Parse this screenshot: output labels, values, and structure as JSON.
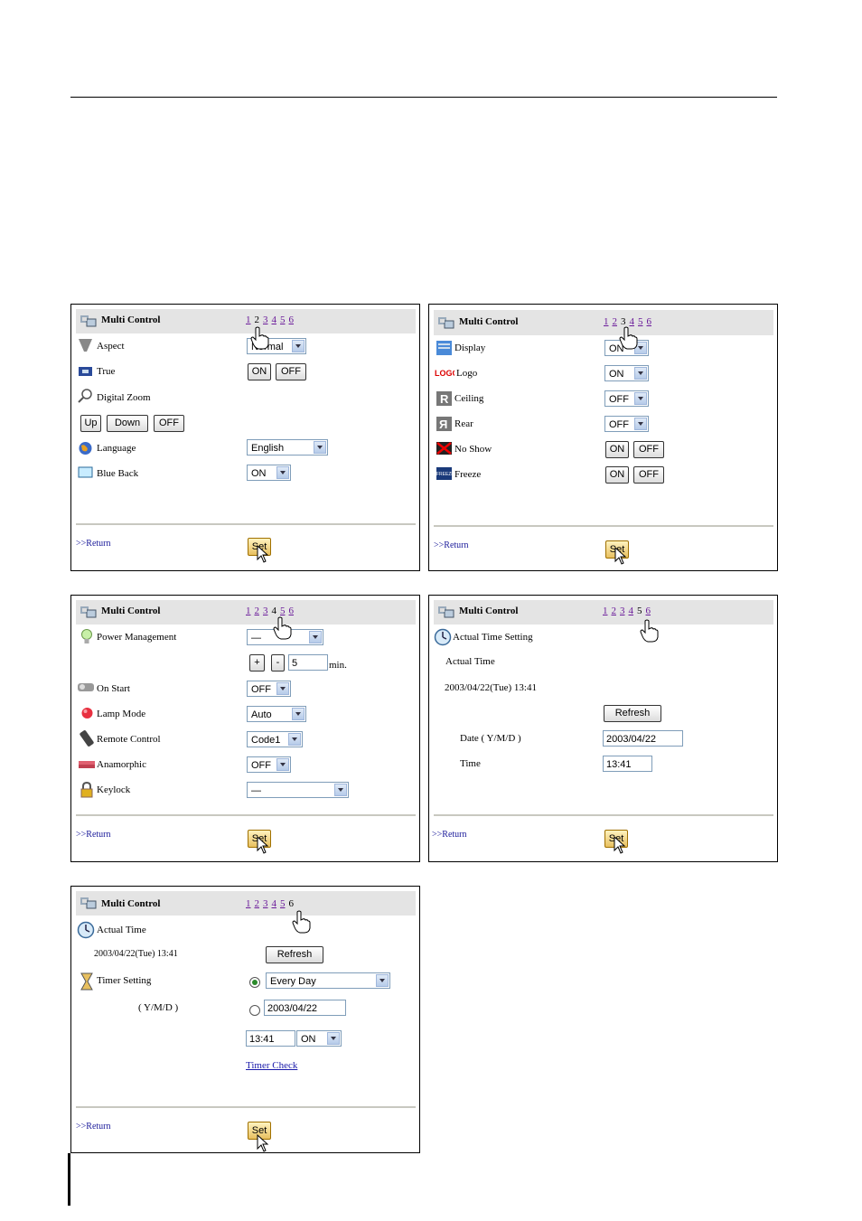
{
  "panels": [
    {
      "title": "Multi Control",
      "pages": [
        "1",
        "2",
        "3",
        "4",
        "5",
        "6"
      ],
      "rows": {
        "aspect": "Aspect",
        "aspect_value": "Normal",
        "true": "True",
        "digital_zoom": "Digital Zoom",
        "language": "Language",
        "language_value": "English",
        "blue_back": "Blue Back",
        "blue_back_value": "ON"
      },
      "buttons": {
        "on": "ON",
        "off": "OFF",
        "up": "Up",
        "down": "Down",
        "zoom_off": "OFF"
      },
      "return": ">>Return",
      "set": "Set"
    },
    {
      "title": "Multi Control",
      "pages": [
        "1",
        "2",
        "3",
        "4",
        "5",
        "6"
      ],
      "rows": {
        "display": "Display",
        "display_value": "ON",
        "logo": "Logo",
        "logo_value": "ON",
        "ceiling": "Ceiling",
        "ceiling_value": "OFF",
        "rear": "Rear",
        "rear_value": "OFF",
        "no_show": "No Show",
        "freeze": "Freeze"
      },
      "buttons": {
        "on": "ON",
        "off": "OFF"
      },
      "return": ">>Return",
      "set": "Set"
    },
    {
      "title": "Multi Control",
      "pages": [
        "1",
        "2",
        "3",
        "4",
        "5",
        "6"
      ],
      "rows": {
        "power_mgmt": "Power Management",
        "power_mgmt_value": "—",
        "plus": "+",
        "minus": "-",
        "minutes_value": "5",
        "min_unit": "min.",
        "on_start": "On Start",
        "on_start_value": "OFF",
        "lamp_mode": "Lamp Mode",
        "lamp_mode_value": "Auto",
        "remote_control": "Remote Control",
        "remote_control_value": "Code1",
        "anamorphic": "Anamorphic",
        "anamorphic_value": "OFF",
        "keylock": "Keylock",
        "keylock_value": "—"
      },
      "return": ">>Return",
      "set": "Set"
    },
    {
      "title": "Multi Control",
      "pages": [
        "1",
        "2",
        "3",
        "4",
        "5",
        "6"
      ],
      "rows": {
        "actual_time_setting": "Actual Time Setting",
        "actual_time": "Actual Time",
        "actual_time_value": "2003/04/22(Tue) 13:41",
        "refresh": "Refresh",
        "date_label": "Date ( Y/M/D )",
        "date_value": "2003/04/22",
        "time_label": "Time",
        "time_value": "13:41"
      },
      "return": ">>Return",
      "set": "Set"
    },
    {
      "title": "Multi Control",
      "pages": [
        "1",
        "2",
        "3",
        "4",
        "5",
        "6"
      ],
      "rows": {
        "actual_time": "Actual Time",
        "actual_time_value": "2003/04/22(Tue) 13:41",
        "refresh": "Refresh",
        "timer_setting": "Timer Setting",
        "every_day": "Every Day",
        "ymd": "( Y/M/D )",
        "date_value": "2003/04/22",
        "time_value": "13:41",
        "on_value": "ON",
        "timer_check": "Timer Check"
      },
      "return": ">>Return",
      "set": "Set"
    }
  ]
}
